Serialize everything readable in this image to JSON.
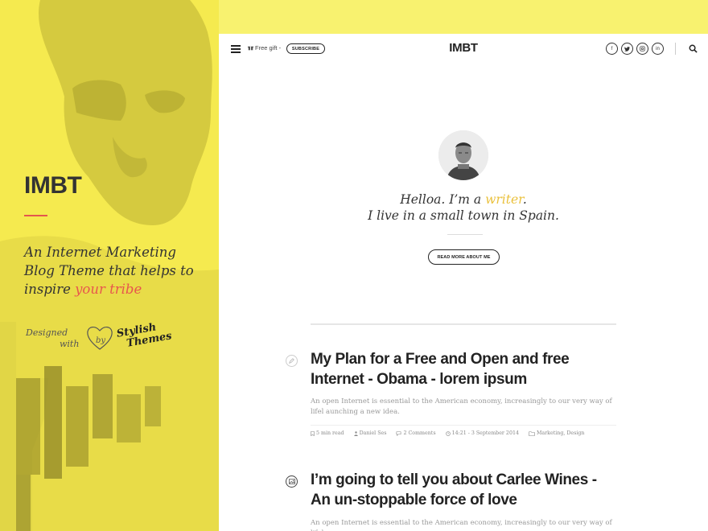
{
  "sidebar": {
    "brand": "IMBT",
    "tagline_part1": "An Internet Marketing Blog Theme that helps to inspire ",
    "tagline_accent": "your tribe",
    "designed_line1": "Designed",
    "designed_line2": "with",
    "designed_by": "by",
    "partner_line1": "Stylish",
    "partner_line2": "Themes"
  },
  "header": {
    "gift_label": "Free gift -",
    "subscribe_label": "SUBSCRIBE",
    "logo": "IMBT",
    "socials": [
      "f",
      "t",
      "in",
      "in"
    ]
  },
  "intro": {
    "line1_prefix": "Helloa. I’m a ",
    "line1_accent": "writer",
    "line1_suffix": ".",
    "line2": "I live in a small town in Spain.",
    "read_more_label": "READ MORE ABOUT ME"
  },
  "posts": [
    {
      "title": "My Plan for a Free and Open and free Internet - Obama  - lorem ipsum",
      "excerpt": "An open Internet is essential to the American economy, increasingly to our very way of lifel aunching a new idea.",
      "read_time": "5 min read",
      "author": "Daniel Ses",
      "comments": "2 Comments",
      "date": "14:21 - 3 September 2014",
      "categories": "Marketing, Design"
    },
    {
      "title": "I’m going to tell you about Carlee Wines - An un-stoppable force of love",
      "excerpt": "An open Internet is essential to the American economy, increasingly to our very way of lifel"
    }
  ],
  "colors": {
    "yellow": "#f5ea4f",
    "accent_red": "#e4574d",
    "accent_gold": "#eac13d"
  }
}
